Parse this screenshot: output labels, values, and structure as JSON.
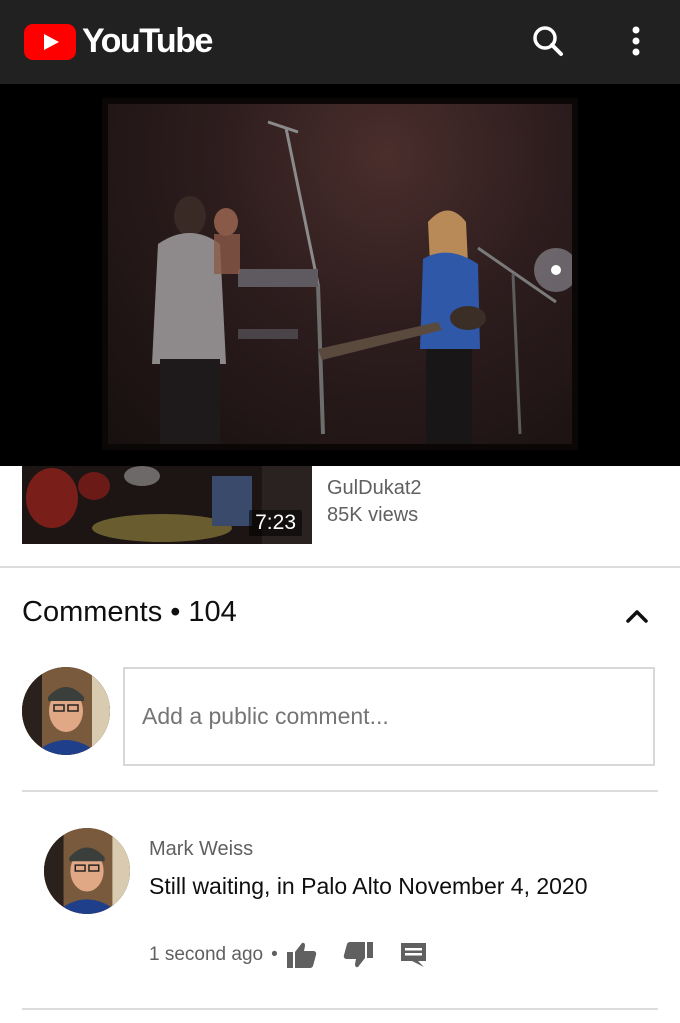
{
  "app": {
    "name": "YouTube",
    "brand_color": "#ff0000",
    "header_bg": "#212121"
  },
  "header": {
    "search_icon": "search-icon",
    "more_icon": "more-vert-icon"
  },
  "related_video": {
    "duration": "7:23",
    "channel": "GulDukat2",
    "views": "85K views"
  },
  "comments": {
    "title": "Comments",
    "separator": "•",
    "count": "104",
    "collapse_icon": "chevron-up-icon",
    "input_placeholder": "Add a public comment...",
    "items": [
      {
        "author": "Mark Weiss",
        "text": "Still waiting, in Palo Alto November 4, 2020",
        "timestamp": "1 second ago",
        "separator": "•",
        "like_icon": "thumbs-up-icon",
        "dislike_icon": "thumbs-down-icon",
        "reply_icon": "reply-comment-icon"
      }
    ]
  }
}
